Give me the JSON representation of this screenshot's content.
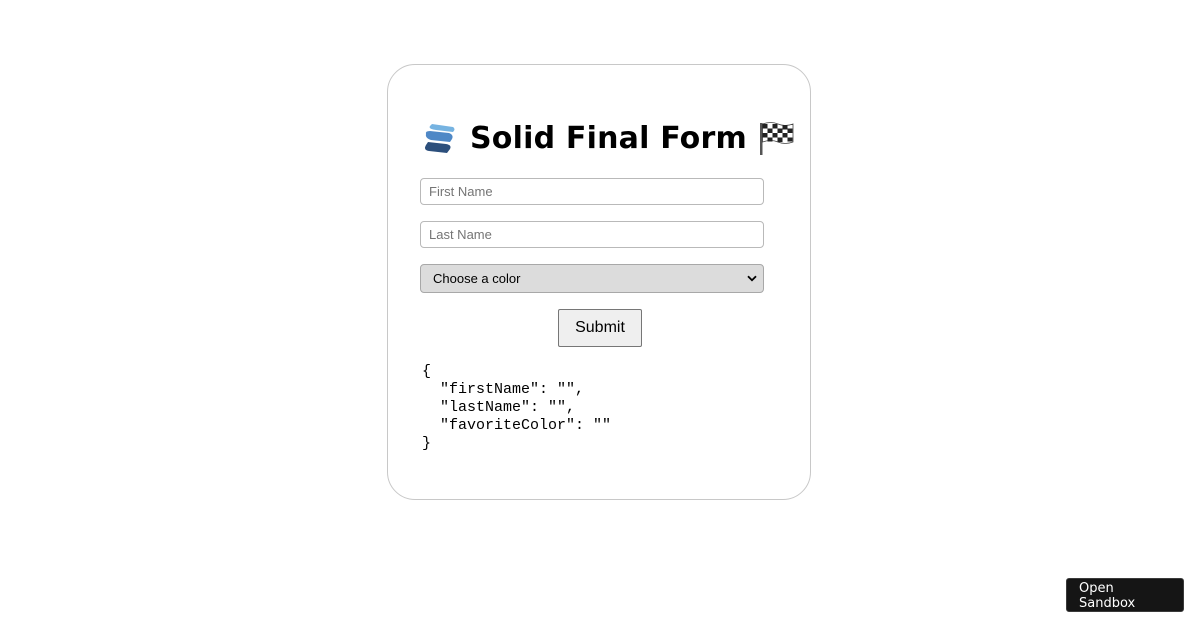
{
  "form": {
    "title": "Solid Final Form",
    "logo_icon": "solid-logo-icon",
    "flag_icon": "checkered-flag-icon",
    "first_name": {
      "value": "",
      "placeholder": "First Name"
    },
    "last_name": {
      "value": "",
      "placeholder": "Last Name"
    },
    "color_select": {
      "selected": "Choose a color"
    },
    "submit_label": "Submit",
    "json_output": "{\n  \"firstName\": \"\",\n  \"lastName\": \"\",\n  \"favoriteColor\": \"\"\n}"
  },
  "sandbox": {
    "open_label": "Open Sandbox"
  },
  "colors": {
    "card_border": "#c8c8c8",
    "select_bg": "#dcdcdc",
    "sandbox_bg": "#151515"
  }
}
